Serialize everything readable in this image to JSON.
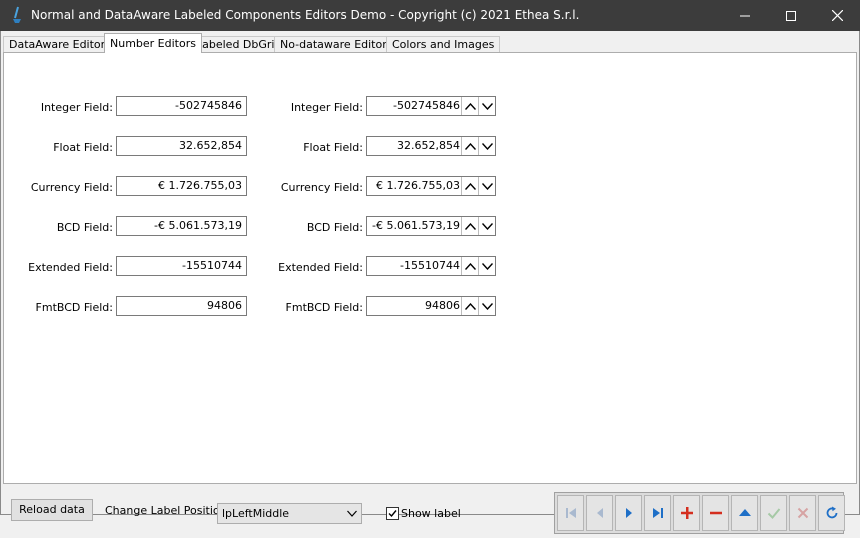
{
  "window": {
    "title": "Normal and DataAware Labeled Components Editors Demo - Copyright (c) 2021 Ethea S.r.l."
  },
  "tabs": [
    {
      "label": "DataAware Editors",
      "active": false
    },
    {
      "label": "Number Editors",
      "active": true
    },
    {
      "label": "Labeled DbGrid",
      "active": false
    },
    {
      "label": "No-dataware Editors",
      "active": false
    },
    {
      "label": "Colors and Images",
      "active": false
    }
  ],
  "left_fields": [
    {
      "label": "Integer Field:",
      "value": "-502745846"
    },
    {
      "label": "Float Field:",
      "value": "32.652,854"
    },
    {
      "label": "Currency Field:",
      "value": "€ 1.726.755,03"
    },
    {
      "label": "BCD Field:",
      "value": "-€ 5.061.573,19"
    },
    {
      "label": "Extended Field:",
      "value": "-15510744"
    },
    {
      "label": "FmtBCD Field:",
      "value": "94806"
    }
  ],
  "right_fields": [
    {
      "label": "Integer Field:",
      "value": "-502745846"
    },
    {
      "label": "Float Field:",
      "value": "32.652,854"
    },
    {
      "label": "Currency Field:",
      "value": "€ 1.726.755,03"
    },
    {
      "label": "BCD Field:",
      "value": "-€ 5.061.573,19"
    },
    {
      "label": "Extended Field:",
      "value": "-15510744"
    },
    {
      "label": "FmtBCD Field:",
      "value": "94806"
    }
  ],
  "bottom": {
    "reload_label": "Reload data",
    "change_label_position_label": "Change Label Position:",
    "label_position_value": "lpLeftMiddle",
    "show_label_text": "Show label",
    "show_label_checked": true
  },
  "navigator": [
    {
      "name": "first-record-icon",
      "enabled": false
    },
    {
      "name": "prior-record-icon",
      "enabled": false
    },
    {
      "name": "next-record-icon",
      "enabled": true
    },
    {
      "name": "last-record-icon",
      "enabled": true
    },
    {
      "name": "insert-record-icon",
      "enabled": true
    },
    {
      "name": "delete-record-icon",
      "enabled": true
    },
    {
      "name": "edit-record-icon",
      "enabled": true
    },
    {
      "name": "post-record-icon",
      "enabled": false
    },
    {
      "name": "cancel-record-icon",
      "enabled": false
    },
    {
      "name": "refresh-records-icon",
      "enabled": true
    }
  ],
  "colors": {
    "titlebar": "#3c3c3c",
    "nav_enabled_blue": "#1e6fc7",
    "nav_disabled_blue": "#a9b9cf",
    "nav_red": "#d42e1f",
    "nav_disabled_green": "#a6c9a6",
    "nav_disabled_red": "#d6a3a3"
  }
}
